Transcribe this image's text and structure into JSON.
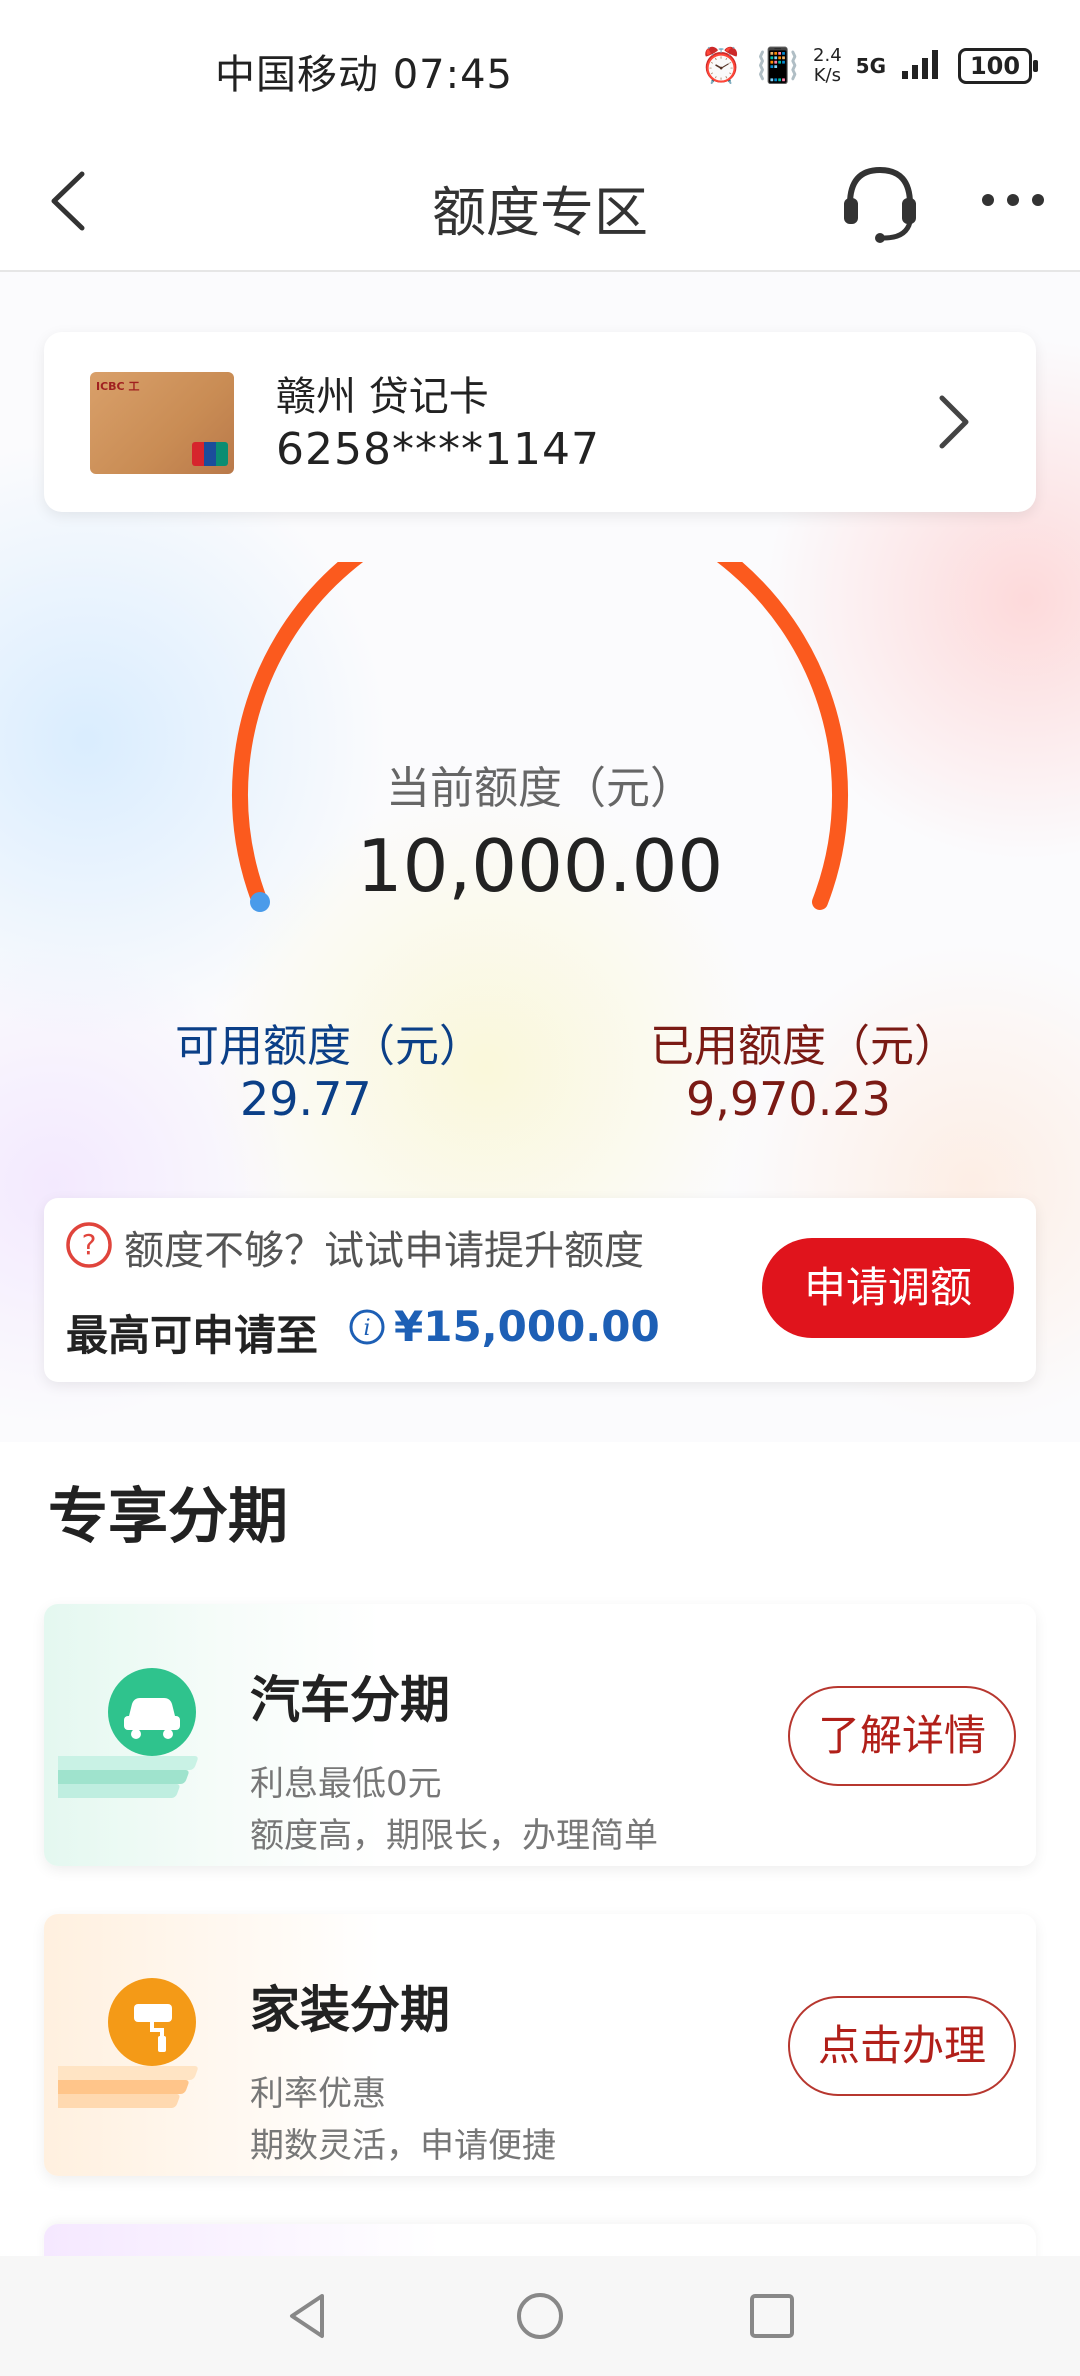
{
  "status_bar": {
    "carrier_time": "中国移动 07:45",
    "speed_value": "2.4",
    "speed_unit": "K/s",
    "network": "5G",
    "battery": "100"
  },
  "header": {
    "title": "额度专区"
  },
  "card": {
    "name": "赣州 贷记卡",
    "number": "6258****1147"
  },
  "gauge": {
    "label": "当前额度（元）",
    "value": "10,000.00",
    "arc_color": "#fb5a1e",
    "end_dot_color": "#4a9bea"
  },
  "available": {
    "label": "可用额度（元）",
    "value": "29.77"
  },
  "used": {
    "label": "已用额度（元）",
    "value": "9,970.23"
  },
  "adjust": {
    "hint": "额度不够？试试申请提升额度",
    "max_label": "最高可申请至",
    "max_value": "¥15,000.00",
    "button": "申请调额"
  },
  "installment": {
    "section_title": "专享分期",
    "items": [
      {
        "title": "汽车分期",
        "line1": "利息最低0元",
        "line2": "额度高，期限长，办理简单",
        "button": "了解详情",
        "icon": "car-icon",
        "accent": "#2fc38d"
      },
      {
        "title": "家装分期",
        "line1": "利率优惠",
        "line2": "期数灵活，申请便捷",
        "button": "点击办理",
        "icon": "paint-roller-icon",
        "accent": "#f49a17"
      }
    ]
  },
  "colors": {
    "primary_red": "#e0141c",
    "link_blue": "#1d5fb5",
    "available_blue": "#0b3f87",
    "used_brown": "#7a1a14"
  }
}
